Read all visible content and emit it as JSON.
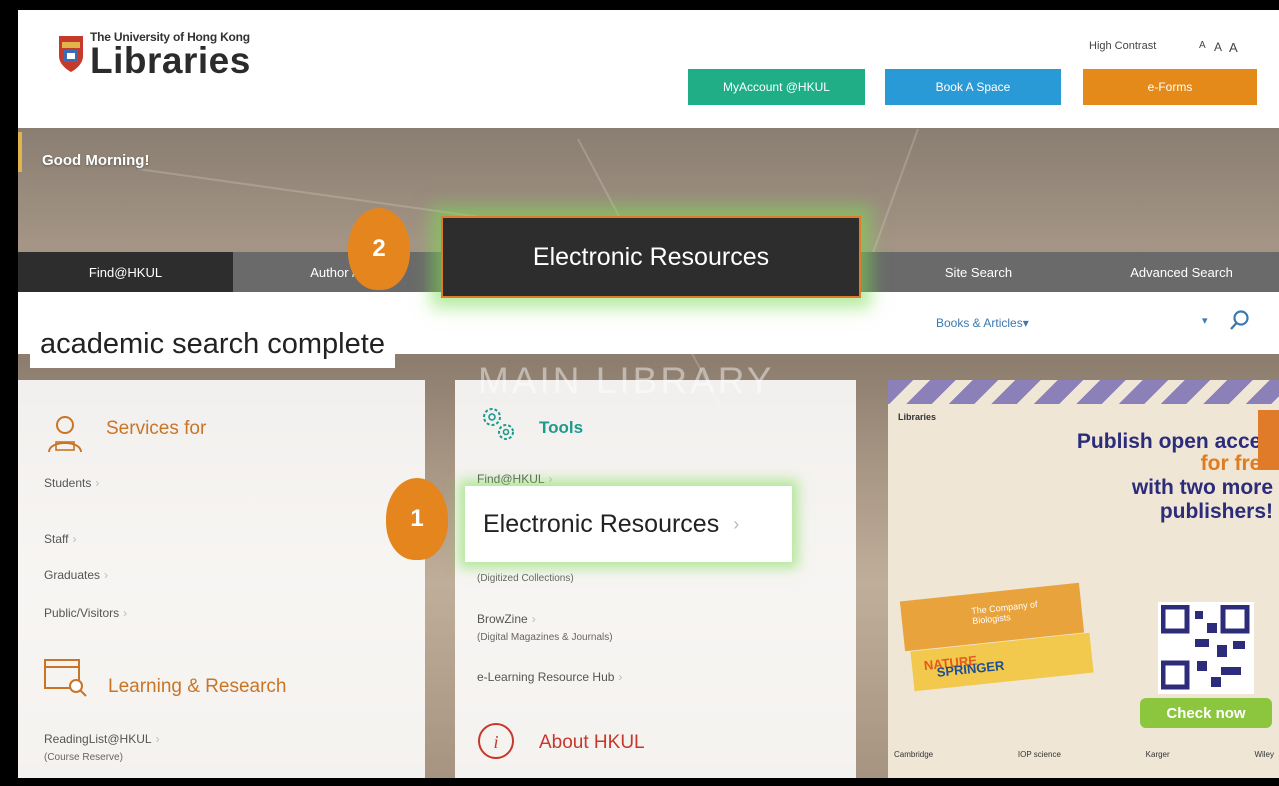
{
  "header": {
    "logo_small": "The University of Hong Kong",
    "logo_big": "Libraries",
    "high_contrast": "High Contrast",
    "font_sizes": [
      "A",
      "A",
      "A"
    ],
    "buttons": {
      "myaccount": "MyAccount @HKUL",
      "book_space": "Book A Space",
      "eforms": "e-Forms"
    }
  },
  "hero": {
    "greeting": "Good Morning!",
    "tabs": [
      "Find@HKUL",
      "Author /",
      "Site Search",
      "Advanced Search"
    ],
    "search_scope": "Books & Articles",
    "watermark": "MAIN LIBRARY"
  },
  "services": {
    "title": "Services for",
    "items": [
      "Students",
      "Staff",
      "Graduates",
      "Public/Visitors"
    ]
  },
  "learning": {
    "title": "Learning & Research",
    "items": [
      {
        "label": "ReadingList@HKUL",
        "sub": "(Course Reserve)"
      }
    ]
  },
  "tools": {
    "title": "Tools",
    "items": [
      {
        "label": "Find@HKUL",
        "sub": ""
      },
      {
        "label": "",
        "sub": "(Digitized Collections)"
      },
      {
        "label": "BrowZine",
        "sub": "(Digital Magazines & Journals)"
      },
      {
        "label": "e-Learning Resource Hub",
        "sub": ""
      }
    ]
  },
  "about": {
    "title": "About HKUL"
  },
  "callouts": {
    "step1_number": "1",
    "step1_label": "Electronic Resources",
    "step2_number": "2",
    "step2_label": "Electronic Resources",
    "query": "academic search complete"
  },
  "banner": {
    "logo": "Libraries",
    "line1": "Publish open acces",
    "line2": "for free",
    "line3": "with two more",
    "line4": "publishers!",
    "ribbon1": "The Company of Biologists",
    "ribbon2_a": "SPRINGER ",
    "ribbon2_b": "NATURE",
    "cta": "Check now",
    "partners": [
      "Cambridge",
      "IOP science",
      "Karger",
      "Wiley"
    ]
  }
}
